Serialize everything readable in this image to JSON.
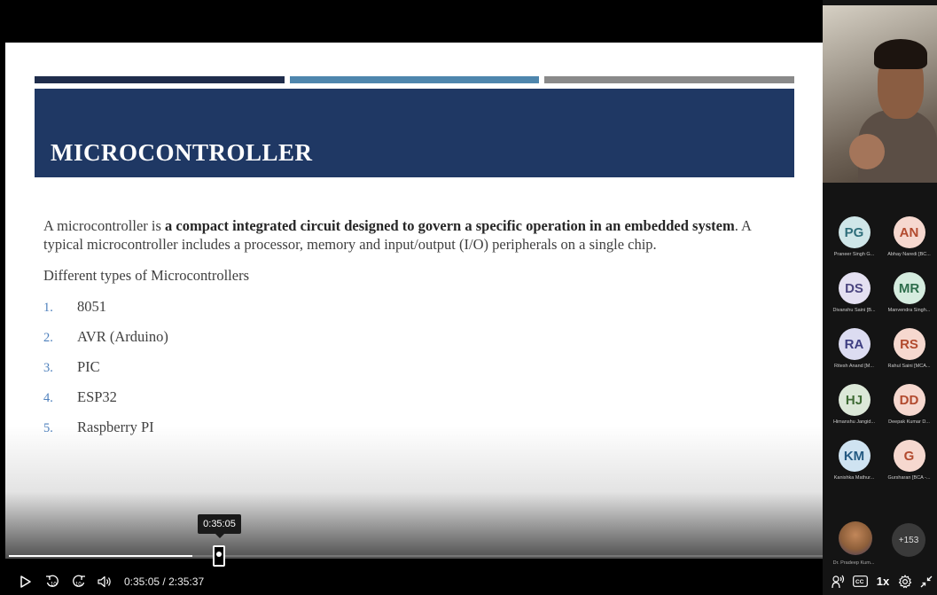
{
  "slide": {
    "title": "MICROCONTROLLER",
    "intro_prefix": "A microcontroller is ",
    "intro_bold": "a compact integrated circuit designed to govern a specific operation in an embedded system",
    "intro_suffix": ". A typical microcontroller includes a processor, memory and input/output (I/O) peripherals on a single chip.",
    "types_heading": "Different types of Microcontrollers",
    "types": [
      {
        "num": "1.",
        "label": "8051"
      },
      {
        "num": "2.",
        "label": "AVR (Arduino)"
      },
      {
        "num": "3.",
        "label": "PIC"
      },
      {
        "num": "4.",
        "label": "ESP32"
      },
      {
        "num": "5.",
        "label": "Raspberry PI"
      }
    ]
  },
  "player": {
    "hover_time": "0:35:05",
    "current_time": "0:35:05",
    "separator": "/",
    "duration": "2:35:37",
    "progress_fraction": 0.2253,
    "speed": "1x",
    "cc_label": "CC",
    "skip_back_label": "10",
    "skip_fwd_label": "10"
  },
  "participants": [
    {
      "initials": "PG",
      "name": "Praneer Singh G...",
      "bg": "#cfe6e8",
      "fg": "#2f6e7a"
    },
    {
      "initials": "AN",
      "name": "Abhay Naredi [BC...",
      "bg": "#f6d8cf",
      "fg": "#b24a2e"
    },
    {
      "initials": "DS",
      "name": "Divanshu Saini [B...",
      "bg": "#e4e0f1",
      "fg": "#4c4680"
    },
    {
      "initials": "MR",
      "name": "Manvendra Singh...",
      "bg": "#d5ecdf",
      "fg": "#2e6e4c"
    },
    {
      "initials": "RA",
      "name": "Ritesh Anand [M...",
      "bg": "#dcdcf1",
      "fg": "#3e3e82"
    },
    {
      "initials": "RS",
      "name": "Rahul Saini [MCA...",
      "bg": "#f6d8cf",
      "fg": "#b24a2e"
    },
    {
      "initials": "HJ",
      "name": "Himanshu Jangid...",
      "bg": "#dce8d8",
      "fg": "#3f6b35"
    },
    {
      "initials": "DD",
      "name": "Deepak Kumar D...",
      "bg": "#f6d8cf",
      "fg": "#b24a2e"
    },
    {
      "initials": "KM",
      "name": "Kanishka Mathur...",
      "bg": "#cfe3f1",
      "fg": "#245a82"
    },
    {
      "initials": "G",
      "name": "Gursharan [BCA -...",
      "bg": "#f6d8cf",
      "fg": "#b24a2e"
    }
  ],
  "presenter_name": "Dr. Pradeep Kum...",
  "more_count": "+153",
  "icons": {
    "play": "play-icon",
    "skip_back": "skip-back-10-icon",
    "skip_fwd": "skip-forward-10-icon",
    "volume": "volume-icon",
    "audio": "audio-description-icon",
    "captions": "captions-icon",
    "settings": "gear-icon",
    "collapse": "collapse-icon"
  }
}
